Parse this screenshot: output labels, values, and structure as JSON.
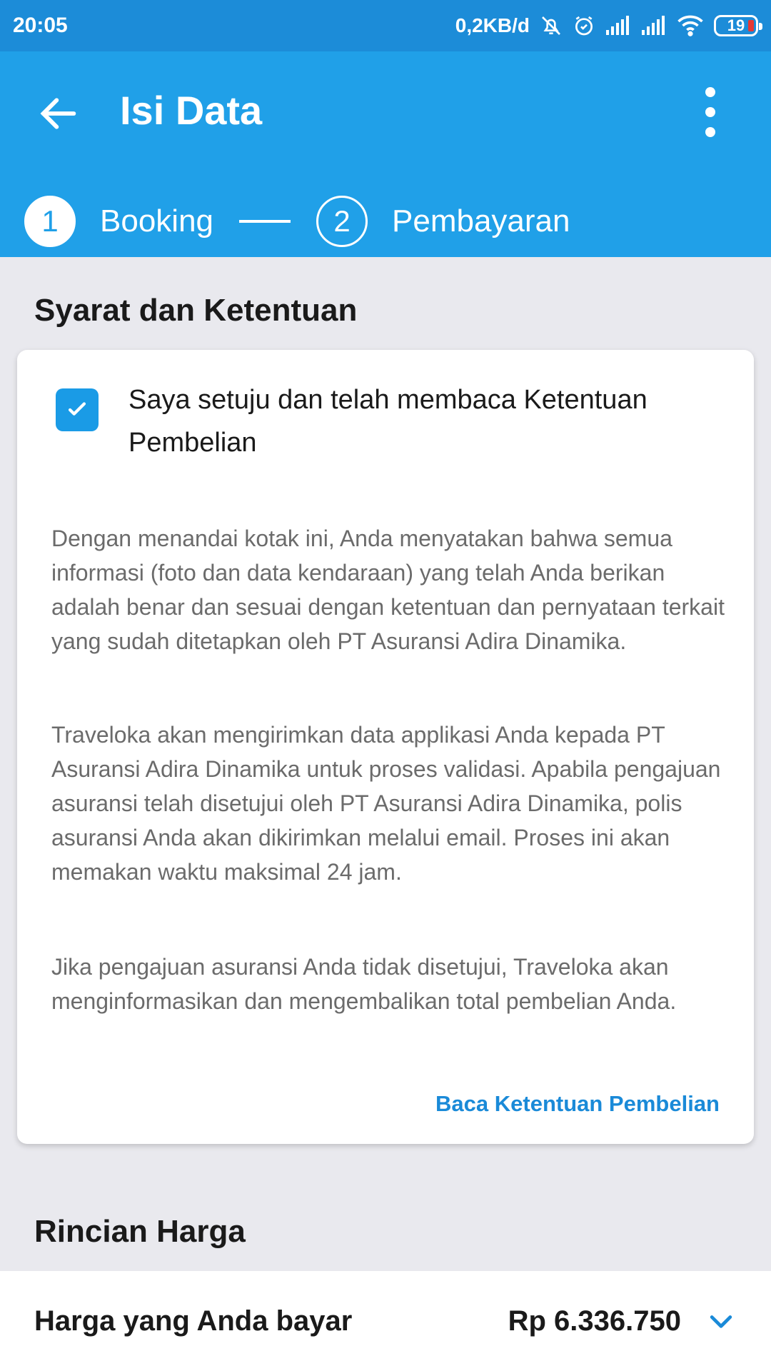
{
  "status": {
    "time": "20:05",
    "speed": "0,2KB/d",
    "battery": "19"
  },
  "appbar": {
    "title": "Isi Data"
  },
  "steps": [
    {
      "number": "1",
      "label": "Booking"
    },
    {
      "number": "2",
      "label": "Pembayaran"
    }
  ],
  "terms": {
    "title": "Syarat dan Ketentuan",
    "agree_label": "Saya setuju dan telah membaca Ketentuan Pembelian",
    "paragraphs": [
      "Dengan menandai kotak ini, Anda menyatakan bahwa semua informasi (foto dan data kendaraan) yang telah Anda berikan adalah benar dan sesuai dengan ketentuan dan pernyataan terkait yang sudah ditetapkan oleh PT Asuransi Adira Dinamika.",
      "Traveloka akan mengirimkan data applikasi Anda kepada PT Asuransi Adira Dinamika untuk proses validasi. Apabila pengajuan asuransi telah disetujui oleh PT Asuransi Adira Dinamika, polis asuransi Anda akan dikirimkan melalui email. Proses ini akan memakan waktu maksimal 24 jam.",
      "Jika pengajuan asuransi Anda tidak disetujui, Traveloka akan menginformasikan dan mengembalikan total pembelian Anda."
    ],
    "link": "Baca Ketentuan Pembelian"
  },
  "price": {
    "section_title": "Rincian Harga",
    "label": "Harga yang Anda bayar",
    "value": "Rp 6.336.750"
  },
  "colors": {
    "primary": "#20a0e8",
    "statusbar": "#1c8cd8",
    "link": "#1a8ad8",
    "background": "#e9e9ee"
  }
}
